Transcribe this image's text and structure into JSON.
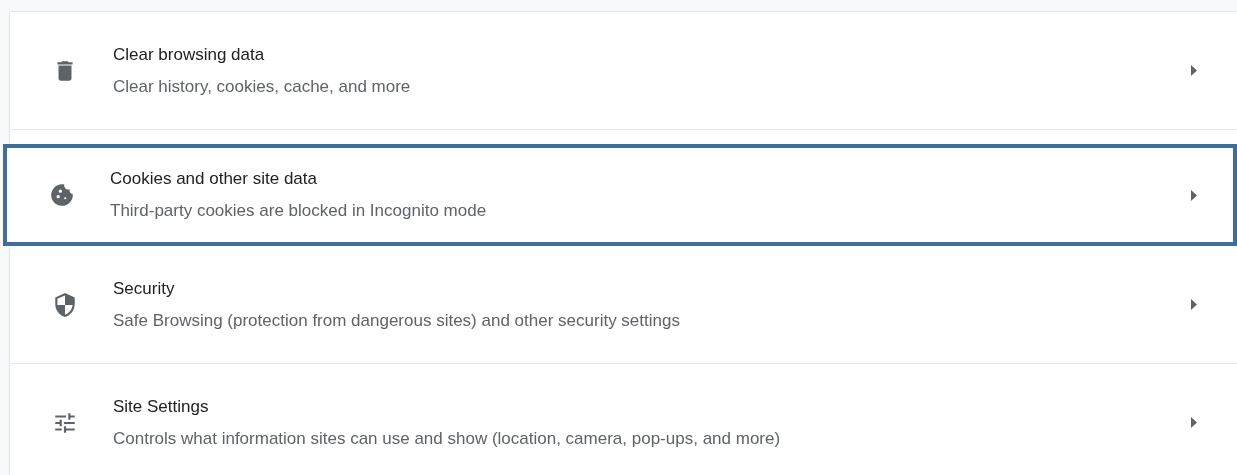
{
  "settings_list": [
    {
      "title": "Clear browsing data",
      "subtitle": "Clear history, cookies, cache, and more",
      "selected": false
    },
    {
      "title": "Cookies and other site data",
      "subtitle": "Third-party cookies are blocked in Incognito mode",
      "selected": true
    },
    {
      "title": "Security",
      "subtitle": "Safe Browsing (protection from dangerous sites) and other security settings",
      "selected": false
    },
    {
      "title": "Site Settings",
      "subtitle": "Controls what information sites can use and show (location, camera, pop-ups, and more)",
      "selected": false
    }
  ]
}
